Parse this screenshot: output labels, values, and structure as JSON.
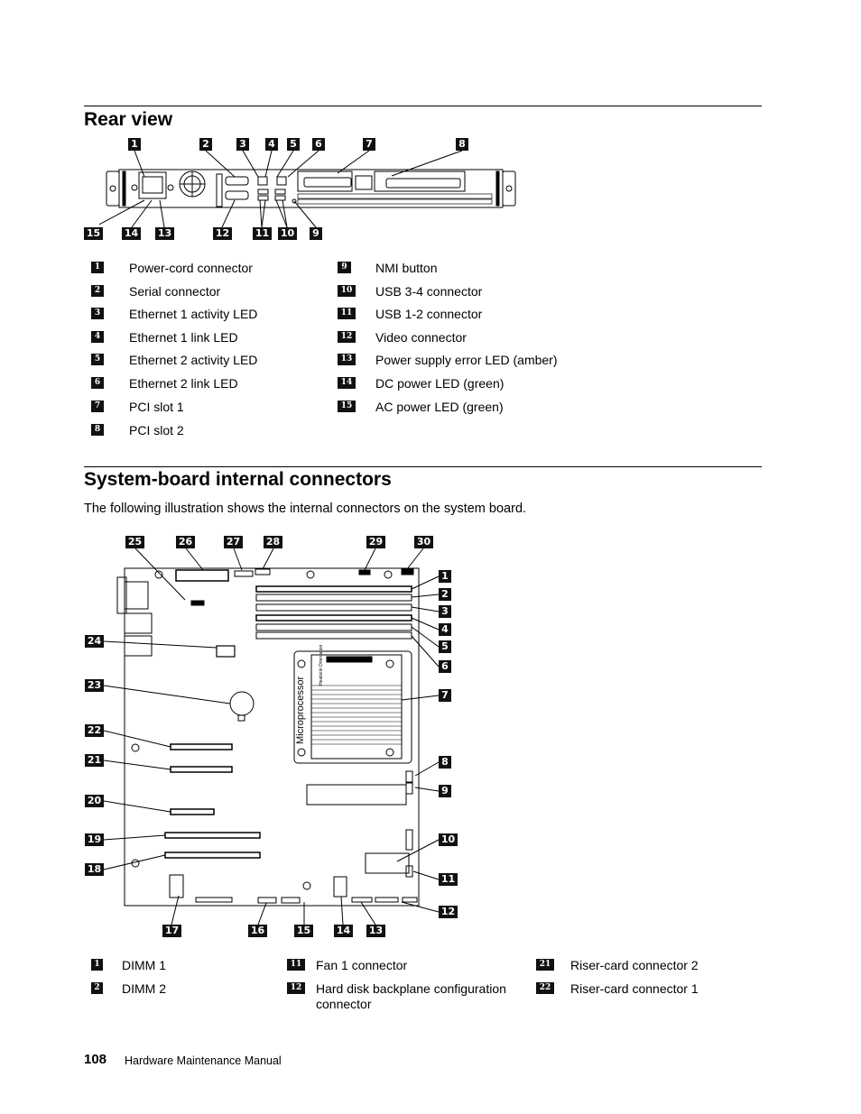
{
  "rear_view": {
    "title": "Rear view",
    "top_callouts": [
      "1",
      "2",
      "3",
      "4",
      "5",
      "6",
      "7",
      "8"
    ],
    "bottom_callouts": [
      "15",
      "14",
      "13",
      "12",
      "11",
      "10",
      "9"
    ],
    "legend": [
      {
        "num": "1",
        "label": "Power-cord connector"
      },
      {
        "num": "2",
        "label": "Serial connector"
      },
      {
        "num": "3",
        "label": "Ethernet 1 activity LED"
      },
      {
        "num": "4",
        "label": "Ethernet 1 link LED"
      },
      {
        "num": "5",
        "label": "Ethernet 2 activity LED"
      },
      {
        "num": "6",
        "label": "Ethernet 2 link LED"
      },
      {
        "num": "7",
        "label": "PCI slot 1"
      },
      {
        "num": "8",
        "label": "PCI slot 2"
      },
      {
        "num": "9",
        "label": "NMI button"
      },
      {
        "num": "10",
        "label": "USB 3-4 connector"
      },
      {
        "num": "11",
        "label": "USB 1-2 connector"
      },
      {
        "num": "12",
        "label": "Video connector"
      },
      {
        "num": "13",
        "label": "Power supply error LED (amber)"
      },
      {
        "num": "14",
        "label": "DC power LED (green)"
      },
      {
        "num": "15",
        "label": "AC power LED (green)"
      }
    ]
  },
  "system_board": {
    "title": "System-board internal connectors",
    "intro": "The following illustration shows the internal connectors on the system board.",
    "top_callouts": [
      "25",
      "26",
      "27",
      "28",
      "29",
      "30"
    ],
    "right_callouts": [
      "1",
      "2",
      "3",
      "4",
      "5",
      "6",
      "7",
      "8",
      "9",
      "10",
      "11",
      "12"
    ],
    "left_callouts": [
      "24",
      "23",
      "22",
      "21",
      "20",
      "19",
      "18"
    ],
    "bottom_callouts": [
      "17",
      "16",
      "15",
      "14",
      "13"
    ],
    "cpu_label": "Microprocessor",
    "heatsink_label": "Heatsink Orientation",
    "legend": [
      {
        "num": "1",
        "label": "DIMM 1"
      },
      {
        "num": "2",
        "label": "DIMM 2"
      },
      {
        "num": "11",
        "label": "Fan 1 connector"
      },
      {
        "num": "12",
        "label": "Hard disk backplane configuration connector"
      },
      {
        "num": "21",
        "label": "Riser-card connector 2"
      },
      {
        "num": "22",
        "label": "Riser-card connector 1"
      }
    ]
  },
  "footer": {
    "page_number": "108",
    "manual_title": "Hardware Maintenance Manual"
  }
}
